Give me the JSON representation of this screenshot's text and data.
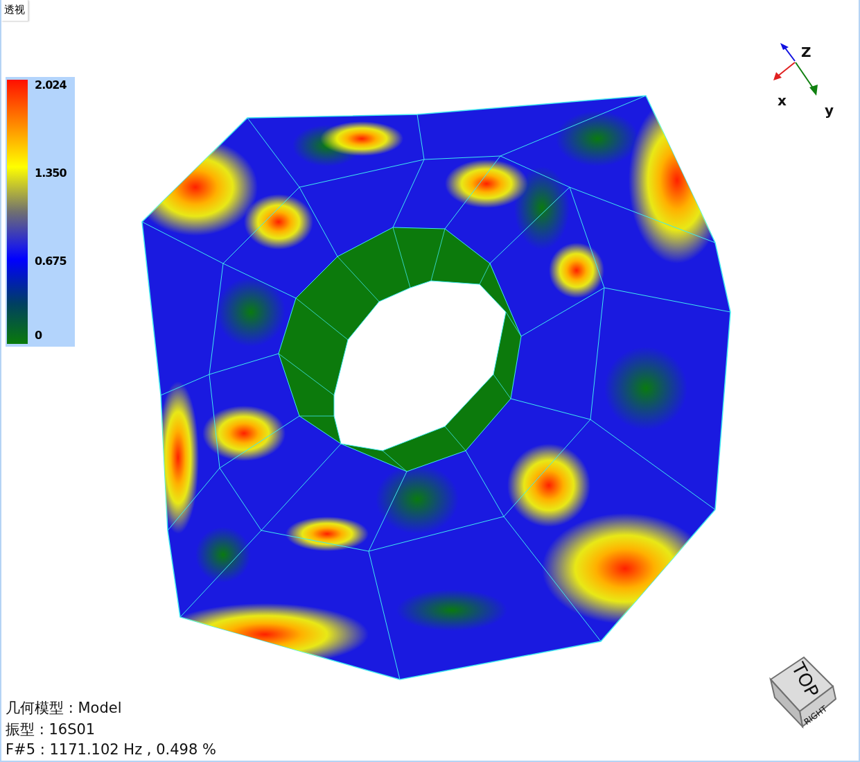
{
  "view_tab": {
    "label": "透视",
    "selected": true
  },
  "legend": {
    "labels": [
      "2.024",
      "1.350",
      "0.675",
      "0"
    ]
  },
  "axes": {
    "x": "x",
    "y": "y",
    "z": "Z"
  },
  "view_cube": {
    "top": "TOP",
    "right": "RIGHT"
  },
  "info": [
    "几何模型 : Model",
    "振型 : 16S01",
    "F#5 : 1171.102 Hz , 0.498 %"
  ]
}
